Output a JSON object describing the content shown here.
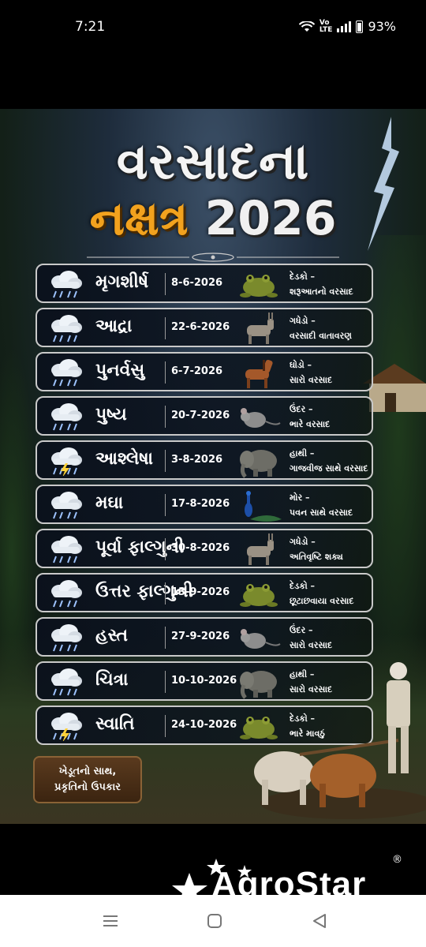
{
  "status": {
    "time": "7:21",
    "volte": "Vo\nLTE",
    "battery": "93%"
  },
  "poster": {
    "title_line1": "વરસાદના",
    "title_line2_gu": "નક્ષત્ર",
    "title_line2_year": "2026",
    "badge_line1": "ખેડૂતનો સાથ,",
    "badge_line2": "પ્રકૃતિનો ઉપકાર",
    "rows": [
      {
        "name": "મૃગશીર્ષ",
        "date": "8-6-2026",
        "animal": "frog-icon",
        "desc1": "દેડકો –",
        "desc2": "શરૂઆતનો વરસાદ",
        "storm": false
      },
      {
        "name": "આદ્રા",
        "date": "22-6-2026",
        "animal": "donkey-icon",
        "desc1": "ગધેડો –",
        "desc2": "વરસાદી વાતાવરણ",
        "storm": false
      },
      {
        "name": "પુનર્વસુ",
        "date": "6-7-2026",
        "animal": "horse-icon",
        "desc1": "ઘોડો –",
        "desc2": "સારો વરસાદ",
        "storm": false
      },
      {
        "name": "પુષ્ય",
        "date": "20-7-2026",
        "animal": "mouse-icon",
        "desc1": "ઉંદર –",
        "desc2": "ભારે વરસાદ",
        "storm": false
      },
      {
        "name": "આશ્લેષા",
        "date": "3-8-2026",
        "animal": "elephant-icon",
        "desc1": "હાથી –",
        "desc2": "ગાજવીજ સાથે વરસાદ",
        "storm": true
      },
      {
        "name": "મઘા",
        "date": "17-8-2026",
        "animal": "peacock-icon",
        "desc1": "મોર –",
        "desc2": "પવન સાથે વરસાદ",
        "storm": false
      },
      {
        "name": "પૂર્વા ફાલ્ગુની",
        "date": "30-8-2026",
        "animal": "donkey-icon",
        "desc1": "ગધેડો –",
        "desc2": "અતિવૃષ્ટિ શક્ય",
        "storm": false
      },
      {
        "name": "ઉત્તર ફાલ્ગુની",
        "date": "13-9-2026",
        "animal": "frog-icon",
        "desc1": "દેડકો –",
        "desc2": "છૂટાછવાયા વરસાદ",
        "storm": false
      },
      {
        "name": "હસ્ત",
        "date": "27-9-2026",
        "animal": "mouse-icon",
        "desc1": "ઉંદર –",
        "desc2": "સારો વરસાદ",
        "storm": false
      },
      {
        "name": "ચિત્રા",
        "date": "10-10-2026",
        "animal": "elephant-icon",
        "desc1": "હાથી –",
        "desc2": "સારો વરસાદ",
        "storm": false
      },
      {
        "name": "સ્વાતિ",
        "date": "24-10-2026",
        "animal": "frog-icon",
        "desc1": "દેડકો –",
        "desc2": "ભારે માવઠું",
        "storm": true
      }
    ]
  },
  "watermark": {
    "brand": "AgroStar",
    "registered": "®"
  },
  "colors": {
    "title_orange": "#f2a21e",
    "row_border": "#c9c9c9"
  }
}
